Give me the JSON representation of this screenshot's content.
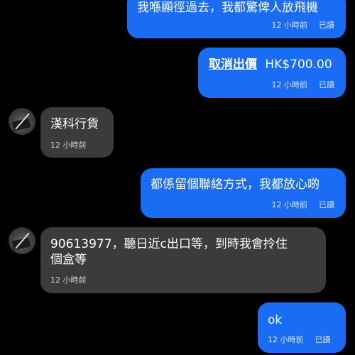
{
  "messages": [
    {
      "text": "我喺顯徑過去，我都驚俾人放飛機",
      "time": "12 小時前",
      "status": "已讀"
    },
    {
      "cancel_label": "取消出價",
      "price": "HK$700.00",
      "time": "12 小時前",
      "status": "已讀"
    },
    {
      "text": "漢科行貨",
      "time": "12 小時前"
    },
    {
      "text": "都係留個聯絡方式，我都放心啲",
      "time": "12 小時前",
      "status": "已讀"
    },
    {
      "text_line1": "90613977，聽日近c出口等，到時我會拎住",
      "text_line2": "個盒等",
      "time": "12 小時前"
    },
    {
      "text": "ok",
      "time": "12 小時前",
      "status": "已讀"
    }
  ],
  "colors": {
    "outgoing": "#1a6cf5",
    "incoming": "#3a3b3d",
    "background": "#000000"
  },
  "icons": {
    "avatar": "seller-avatar"
  }
}
